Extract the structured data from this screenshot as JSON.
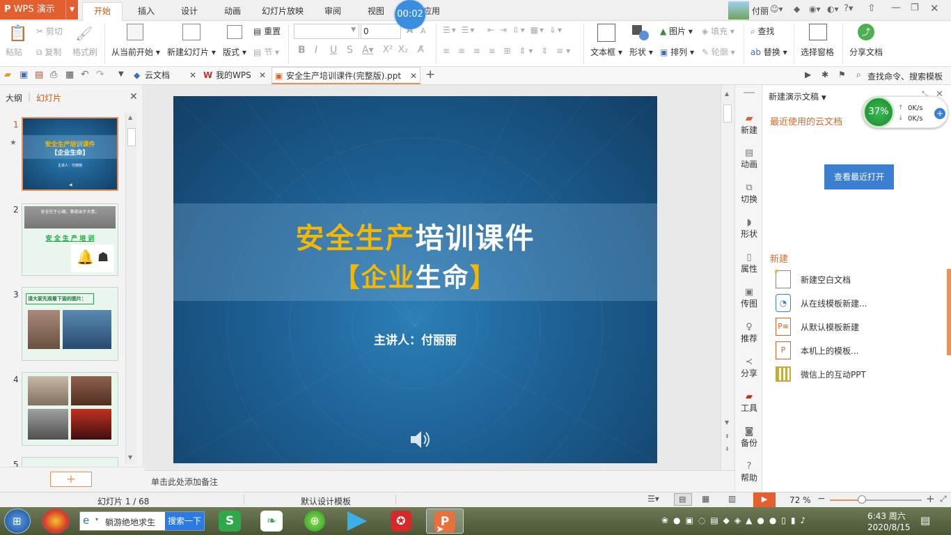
{
  "title_bar": {
    "app_button": "WPS 演示",
    "tabs": [
      "开始",
      "插入",
      "设计",
      "动画",
      "幻灯片放映",
      "审阅",
      "视图",
      "特色应用"
    ],
    "active_tab": "开始",
    "timer": "00:02",
    "user_name": "付丽"
  },
  "ribbon": {
    "paste": "粘贴",
    "cut": "剪切",
    "copy": "复制",
    "format_painter": "格式刷",
    "from_current": "从当前开始",
    "new_slide": "新建幻灯片",
    "layout": "版式",
    "reset": "重置",
    "section": "节",
    "font_size": "0",
    "textbox": "文本框",
    "shape": "形状",
    "picture": "图片",
    "fill": "填充",
    "arrange": "排列",
    "outline": "轮廓",
    "find": "查找",
    "replace": "替换",
    "selection_pane": "选择窗格",
    "share_doc": "分享文档"
  },
  "doc_tabs": {
    "tabs": [
      "云文档",
      "我的WPS",
      "安全生产培训课件(完整版).ppt"
    ],
    "active": "安全生产培训课件(完整版).ppt",
    "search_placeholder": "查找命令、搜索模板"
  },
  "left_panel": {
    "tab_outline": "大纲",
    "tab_slides": "幻灯片",
    "slides": [
      {
        "num": "1",
        "title": "安全生产培训课件",
        "sub": "【企业生命】",
        "presenter": "主讲人：付丽丽"
      },
      {
        "num": "2",
        "banner": "安全在于心细，事故出于大意。",
        "title": "安 全 生 产 培 训"
      },
      {
        "num": "3",
        "caption": "请大家先观看下面的图片："
      },
      {
        "num": "4"
      },
      {
        "num": "5"
      }
    ]
  },
  "slide": {
    "title_yellow": "安全生产",
    "title_white": "培训课件",
    "subtitle_open": "【",
    "subtitle_yellow": "企业",
    "subtitle_white": "生命",
    "subtitle_close": "】",
    "presenter": "主讲人：付丽丽"
  },
  "notes": {
    "placeholder": "单击此处添加备注"
  },
  "sidebar": {
    "items": [
      "新建",
      "动画",
      "切换",
      "形状",
      "属性",
      "传图",
      "推荐",
      "分享",
      "工具",
      "备份",
      "帮助"
    ]
  },
  "task_pane": {
    "header": "新建演示文稿",
    "recent_cloud": "最近使用的云文档",
    "view_recent_button": "查看最近打开",
    "new_section": "新建",
    "new_items": [
      "新建空白文档",
      "从在线模板新建...",
      "从默认模板新建",
      "本机上的模板...",
      "微信上的互动PPT"
    ],
    "net_percent": "37%",
    "net_up": "0K/s",
    "net_down": "0K/s"
  },
  "status_bar": {
    "slide_counter": "幻灯片 1 / 68",
    "template": "默认设计模板",
    "zoom": "72 %"
  },
  "taskbar": {
    "ie_text": "躺游绝地求生",
    "search_button": "搜索一下",
    "time": "6:43 周六",
    "date": "2020/8/15"
  },
  "colors": {
    "accent_orange": "#e35f2f",
    "slide_yellow": "#f5b800",
    "pane_blue": "#3b7fd3",
    "recent_orange": "#d26a2c"
  }
}
